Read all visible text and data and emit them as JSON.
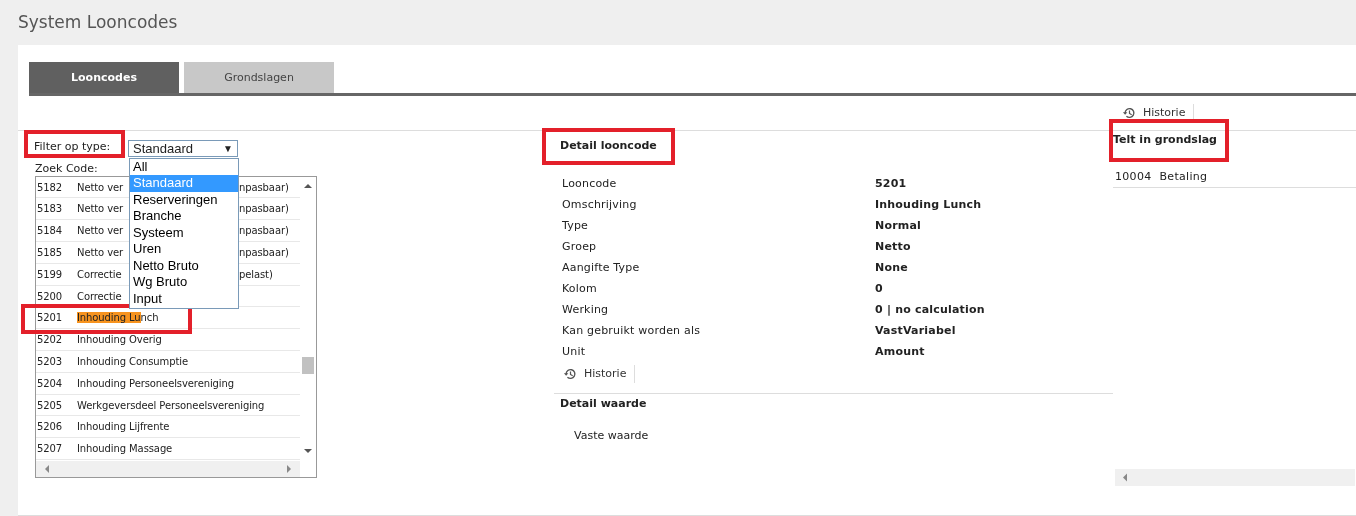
{
  "page_title": "System Looncodes",
  "tabs": [
    {
      "label": "Looncodes",
      "selected": true
    },
    {
      "label": "Grondslagen",
      "selected": false
    }
  ],
  "top_history": {
    "label": "Historie"
  },
  "filter": {
    "label": "Filter op type:",
    "annotated": true,
    "value": "Standaard",
    "arrow": "▼",
    "open": true,
    "options": [
      {
        "label": "All",
        "selected": false
      },
      {
        "label": "Standaard",
        "selected": true
      },
      {
        "label": "Reserveringen",
        "selected": false
      },
      {
        "label": "Branche",
        "selected": false
      },
      {
        "label": "Systeem",
        "selected": false
      },
      {
        "label": "Uren",
        "selected": false
      },
      {
        "label": "Netto Bruto",
        "selected": false
      },
      {
        "label": "Wg Bruto",
        "selected": false
      },
      {
        "label": "Input",
        "selected": false
      }
    ]
  },
  "search": {
    "label": "Zoek Code:"
  },
  "codes": [
    {
      "code": "5182",
      "name": "Netto ver",
      "name_right": "npasbaar)",
      "annotated": false
    },
    {
      "code": "5183",
      "name": "Netto ver",
      "name_right": "npasbaar)",
      "annotated": false
    },
    {
      "code": "5184",
      "name": "Netto ver",
      "name_right": "npasbaar)",
      "annotated": false
    },
    {
      "code": "5185",
      "name": "Netto ver",
      "name_right": "npasbaar)",
      "annotated": false
    },
    {
      "code": "5199",
      "name": "Correctie",
      "name_right": "pelast)",
      "annotated": false
    },
    {
      "code": "5200",
      "name": "Correctie",
      "annotated": false
    },
    {
      "code": "5201",
      "highlight": "Inhouding Lu",
      "name": "nch",
      "annotated": true
    },
    {
      "code": "5202",
      "name": "Inhouding Overig",
      "annotated": false
    },
    {
      "code": "5203",
      "name": "Inhouding Consumptie",
      "annotated": false
    },
    {
      "code": "5204",
      "name": "Inhouding Personeelsvereniging",
      "annotated": false
    },
    {
      "code": "5205",
      "name": "Werkgeversdeel Personeelsvereniging",
      "annotated": false
    },
    {
      "code": "5206",
      "name": "Inhouding Lijfrente",
      "annotated": false
    },
    {
      "code": "5207",
      "name": "Inhouding Massage",
      "annotated": false
    }
  ],
  "detail": {
    "title": "Detail looncode",
    "annotated": true,
    "fields": [
      {
        "label": "Looncode",
        "value": "5201"
      },
      {
        "label": "Omschrijving",
        "value": "Inhouding Lunch"
      },
      {
        "label": "Type",
        "value": "Normal"
      },
      {
        "label": "Groep",
        "value": "Netto"
      },
      {
        "label": "Aangifte Type",
        "value": "None"
      },
      {
        "label": "Kolom",
        "value": "0"
      },
      {
        "label": "Werking",
        "value": "0 | no calculation"
      },
      {
        "label": "Kan gebruikt worden als",
        "value": "VastVariabel"
      },
      {
        "label": "Unit",
        "value": "Amount"
      }
    ],
    "history": "Historie",
    "value_title": "Detail waarde",
    "value_fields": [
      {
        "label": "Vaste waarde"
      }
    ]
  },
  "grondslag": {
    "title": "Telt in grondslag",
    "annotated": true,
    "rows": [
      {
        "code": "10004",
        "name": "Betaling"
      }
    ]
  }
}
